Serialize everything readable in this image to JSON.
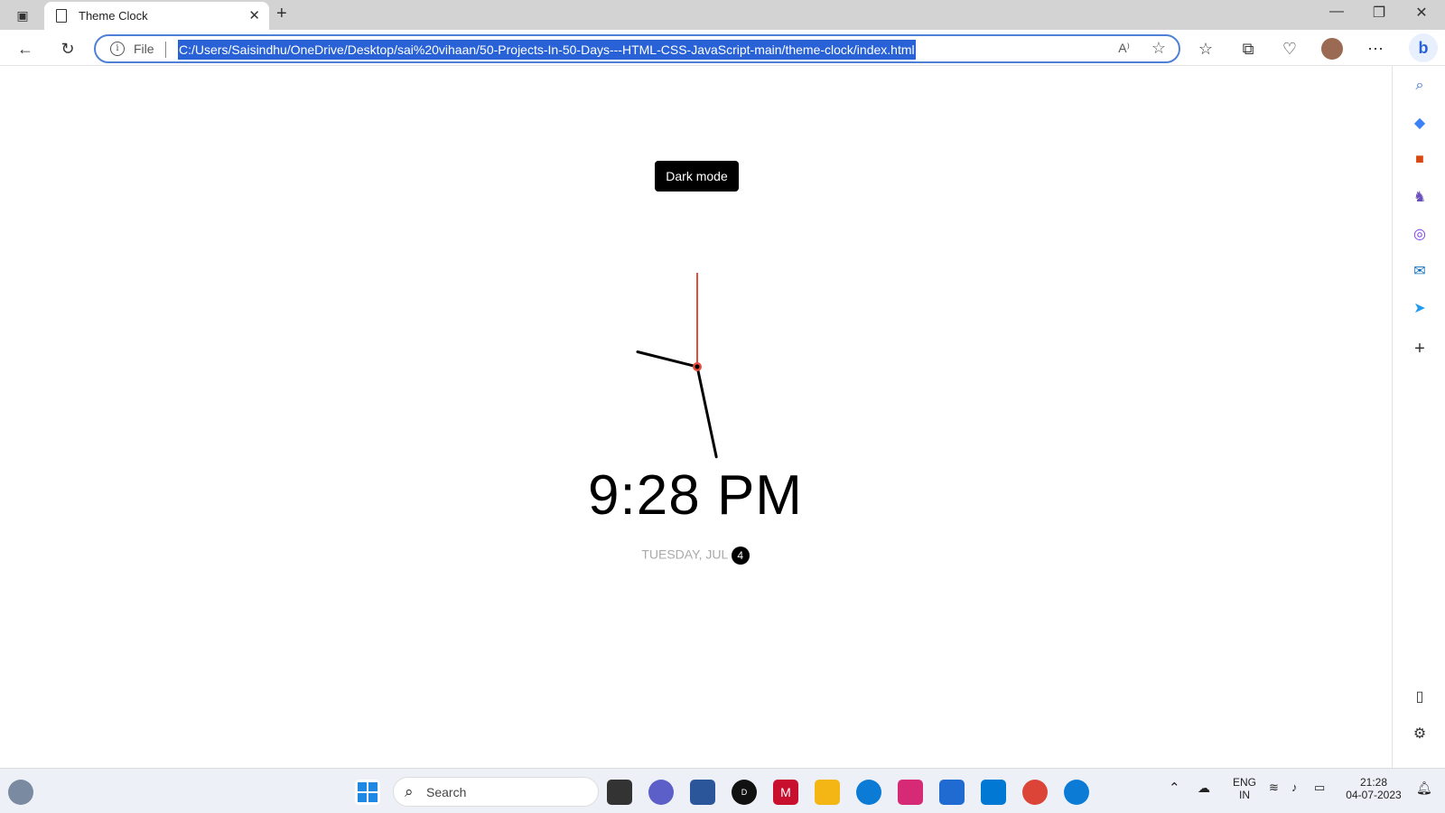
{
  "browser": {
    "tab_title": "Theme Clock",
    "file_label": "File",
    "url": "C:/Users/Saisindhu/OneDrive/Desktop/sai%20vihaan/50-Projects-In-50-Days---HTML-CSS-JavaScript-main/theme-clock/index.html"
  },
  "page": {
    "toggle_label": "Dark mode",
    "time_text": "9:28 PM",
    "date_prefix": "TUESDAY, JUL",
    "date_day": "4",
    "clock": {
      "hour": 21,
      "minute": 28,
      "second": 0
    }
  },
  "taskbar": {
    "search_placeholder": "Search",
    "lang_line1": "ENG",
    "lang_line2": "IN",
    "clock_time": "21:28",
    "clock_date": "04-07-2023"
  },
  "colors": {
    "accent": "#2962d6",
    "second_hand": "#e74c3c",
    "hand": "#000000"
  }
}
